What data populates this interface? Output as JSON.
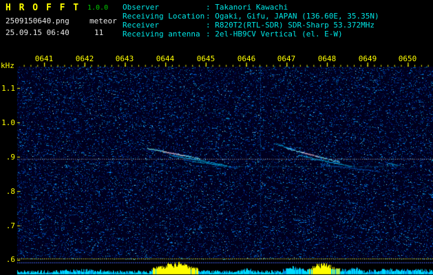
{
  "app": {
    "title": "H R O F F T",
    "version": "1.0.0",
    "filename": "2509150640.png",
    "mode": "meteor",
    "datetime": "25.09.15 06:40",
    "count": "11"
  },
  "info": {
    "rows": [
      {
        "label": "Observer",
        "value": ": Takanori Kawachi"
      },
      {
        "label": "Receiving Location",
        "value": ": Ogaki, Gifu, JAPAN (136.60E, 35.35N)"
      },
      {
        "label": "Receiver",
        "value": ": R820T2(RTL-SDR) SDR-Sharp 53.372MHz"
      },
      {
        "label": "Receiving antenna",
        "value": ": 2el-HB9CV Vertical (el. E-W)"
      }
    ]
  },
  "colors": {
    "accent_yellow": "#ffff00",
    "text_cyan": "#00e6e6",
    "version_green": "#00cc00",
    "noise_cyan": "#00dcff",
    "noise_blue": "#0096e6",
    "saturation_yellow": "#ffff00",
    "background": "#000000",
    "spectrogram_base": "#000028"
  },
  "chart_data": {
    "type": "heatmap",
    "title": "HROFFT 10-minute radio meteor spectrogram 06:40-06:50",
    "meteor_count": 11,
    "x": {
      "ticks": [
        "0641",
        "0642",
        "0643",
        "0644",
        "0645",
        "0646",
        "0647",
        "0648",
        "0649",
        "0650"
      ]
    },
    "y": {
      "label": "kHz",
      "tick_labels": [
        "1.1",
        "1.0",
        ".9",
        ".8",
        ".7",
        ".6"
      ],
      "range_khz": [
        0.6,
        1.16
      ]
    },
    "marker_lines": [
      {
        "freq_khz": 0.894,
        "color": "#ffffff",
        "style": "dotted"
      },
      {
        "freq_khz": 0.604,
        "color": "#ffff00",
        "style": "dotted"
      }
    ],
    "echo_traces": [
      {
        "t0_min": 43.55,
        "t1_min": 44.85,
        "f0_khz": 0.925,
        "f1_khz": 0.895,
        "intensity": 0.85,
        "core_min": 44.15,
        "core_intensity": 0.7
      },
      {
        "t0_min": 44.1,
        "t1_min": 45.5,
        "f0_khz": 0.906,
        "f1_khz": 0.875,
        "intensity": 0.45
      },
      {
        "t0_min": 44.45,
        "t1_min": 45.8,
        "f0_khz": 0.892,
        "f1_khz": 0.868,
        "intensity": 0.3
      },
      {
        "t0_min": 46.7,
        "t1_min": 47.15,
        "f0_khz": 0.94,
        "f1_khz": 0.922,
        "intensity": 0.5
      },
      {
        "t0_min": 47.0,
        "t1_min": 48.3,
        "f0_khz": 0.925,
        "f1_khz": 0.885,
        "intensity": 0.8,
        "core_min": 47.55,
        "core_intensity": 1.0
      },
      {
        "t0_min": 47.3,
        "t1_min": 48.6,
        "f0_khz": 0.905,
        "f1_khz": 0.872,
        "intensity": 0.45
      },
      {
        "t0_min": 47.85,
        "t1_min": 49.3,
        "f0_khz": 0.878,
        "f1_khz": 0.858,
        "intensity": 0.25
      },
      {
        "t0_min": 49.45,
        "t1_min": 49.8,
        "f0_khz": 0.884,
        "f1_khz": 0.875,
        "intensity": 0.3
      }
    ],
    "carrier_traces": [
      {
        "t0_min": 45.75,
        "t1_min": 49.9,
        "f_khz": 0.872,
        "intensity": 0.35
      },
      {
        "t0_min": 40.8,
        "t1_min": 45.75,
        "f_khz": 0.872,
        "intensity": 0.13
      }
    ],
    "vertical_interference_min": [
      46.35
    ],
    "amplitude_segments": [
      {
        "t0_min": 41.4,
        "t1_min": 42.6,
        "boost": 2.0,
        "saturated": false
      },
      {
        "t0_min": 43.65,
        "t1_min": 44.8,
        "boost": 13.0,
        "saturated": true
      },
      {
        "t0_min": 45.85,
        "t1_min": 46.15,
        "boost": 4.0,
        "saturated": false
      },
      {
        "t0_min": 46.9,
        "t1_min": 47.5,
        "boost": 7.0,
        "saturated": false
      },
      {
        "t0_min": 47.5,
        "t1_min": 48.32,
        "boost": 12.0,
        "saturated": true
      },
      {
        "t0_min": 48.32,
        "t1_min": 48.9,
        "boost": 5.0,
        "saturated": false
      },
      {
        "t0_min": 49.0,
        "t1_min": 50.6,
        "boost": 3.5,
        "saturated": false
      }
    ]
  }
}
